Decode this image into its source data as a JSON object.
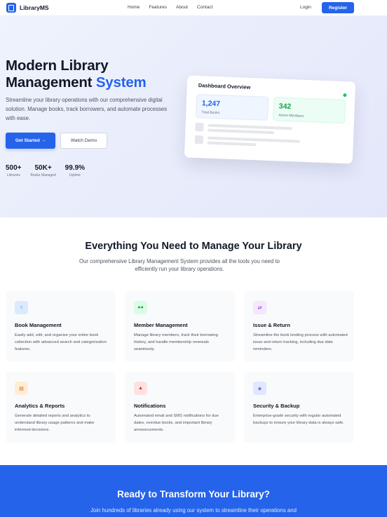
{
  "nav": {
    "brand": "LibraryMS",
    "links": [
      "Home",
      "Features",
      "About",
      "Contact"
    ],
    "login": "Login",
    "register": "Register"
  },
  "hero": {
    "title_line1": "Modern Library",
    "title_line2_prefix": "Management ",
    "title_line2_accent": "System",
    "subtitle": "Streamline your library operations with our comprehensive digital solution. Manage books, track borrowers, and automate processes with ease.",
    "primary_button": "Get Started →",
    "secondary_button": "Watch Demo",
    "stats": [
      {
        "value": "500+",
        "label": "Libraries"
      },
      {
        "value": "50K+",
        "label": "Books Managed"
      },
      {
        "value": "99.9%",
        "label": "Uptime"
      }
    ]
  },
  "dashboard": {
    "title": "Dashboard Overview",
    "cards": [
      {
        "value": "1,247",
        "label": "Total Books"
      },
      {
        "value": "342",
        "label": "Active Members"
      }
    ]
  },
  "features": {
    "title": "Everything You Need to Manage Your Library",
    "subtitle": "Our comprehensive Library Management System provides all the tools you need to efficiently run your library operations.",
    "items": [
      {
        "title": "Book Management",
        "desc": "Easily add, edit, and organize your entire book collection with advanced search and categorization features.",
        "icon": "book-icon"
      },
      {
        "title": "Member Management",
        "desc": "Manage library members, track their borrowing history, and handle membership renewals seamlessly.",
        "icon": "users-icon"
      },
      {
        "title": "Issue & Return",
        "desc": "Streamline the book lending process with automated issue and return tracking, including due date reminders.",
        "icon": "swap-icon"
      },
      {
        "title": "Analytics & Reports",
        "desc": "Generate detailed reports and analytics to understand library usage patterns and make informed decisions.",
        "icon": "chart-icon"
      },
      {
        "title": "Notifications",
        "desc": "Automated email and SMS notifications for due dates, overdue books, and important library announcements.",
        "icon": "bell-icon"
      },
      {
        "title": "Security & Backup",
        "desc": "Enterprise-grade security with regular automated backups to ensure your library data is always safe.",
        "icon": "shield-icon"
      }
    ]
  },
  "cta": {
    "title": "Ready to Transform Your Library?",
    "subtitle": "Join hundreds of libraries already using our system to streamline their operations and"
  },
  "colors": {
    "accent": "#2563eb",
    "success": "#22c55e"
  }
}
